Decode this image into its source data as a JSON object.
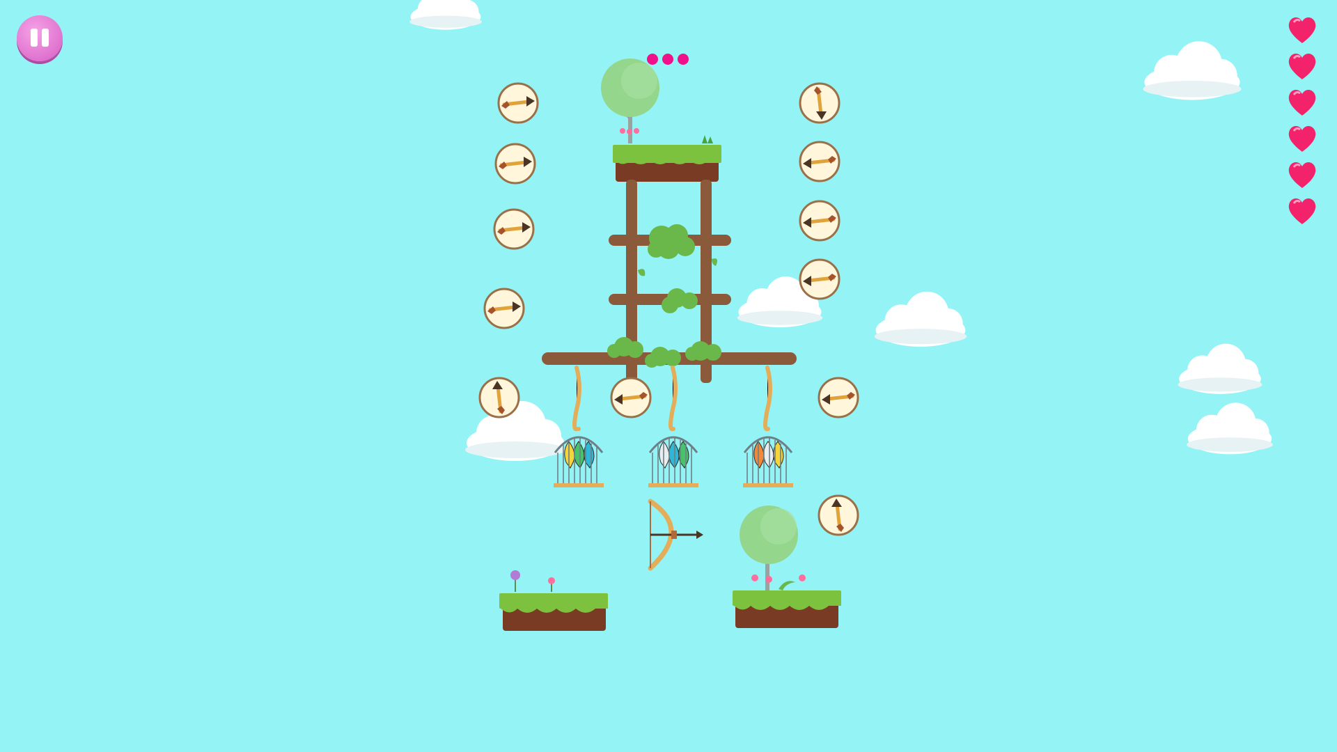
{
  "colors": {
    "sky": "#93f3f5",
    "heart": "#f2226b",
    "progress_dot": "#f0118a",
    "grass": "#7cc23f",
    "dirt": "#7a3b24",
    "wood": "#8a5a3b",
    "token_fill": "#fff6dc",
    "token_border": "#9a7048",
    "pause_button": "#df73cf"
  },
  "hud": {
    "pause_icon": "pause-icon",
    "lives": 6,
    "progress_dots": 3
  },
  "arrow_tokens": [
    {
      "direction": "right"
    },
    {
      "direction": "right"
    },
    {
      "direction": "right"
    },
    {
      "direction": "right"
    },
    {
      "direction": "up"
    },
    {
      "direction": "left"
    },
    {
      "direction": "down"
    },
    {
      "direction": "left"
    },
    {
      "direction": "left"
    },
    {
      "direction": "left"
    },
    {
      "direction": "left"
    },
    {
      "direction": "up"
    }
  ],
  "cages": [
    {
      "birds": [
        "yellow-bird",
        "green-bird",
        "blue-bird"
      ]
    },
    {
      "birds": [
        "white-bird",
        "blue-bird",
        "green-bird"
      ]
    },
    {
      "birds": [
        "orange-bird",
        "white-bird",
        "yellow-bird"
      ]
    }
  ],
  "bow": {
    "aim": "right"
  },
  "decor": [
    "cloud",
    "tree",
    "flower",
    "grass-platform",
    "wooden-tower"
  ]
}
